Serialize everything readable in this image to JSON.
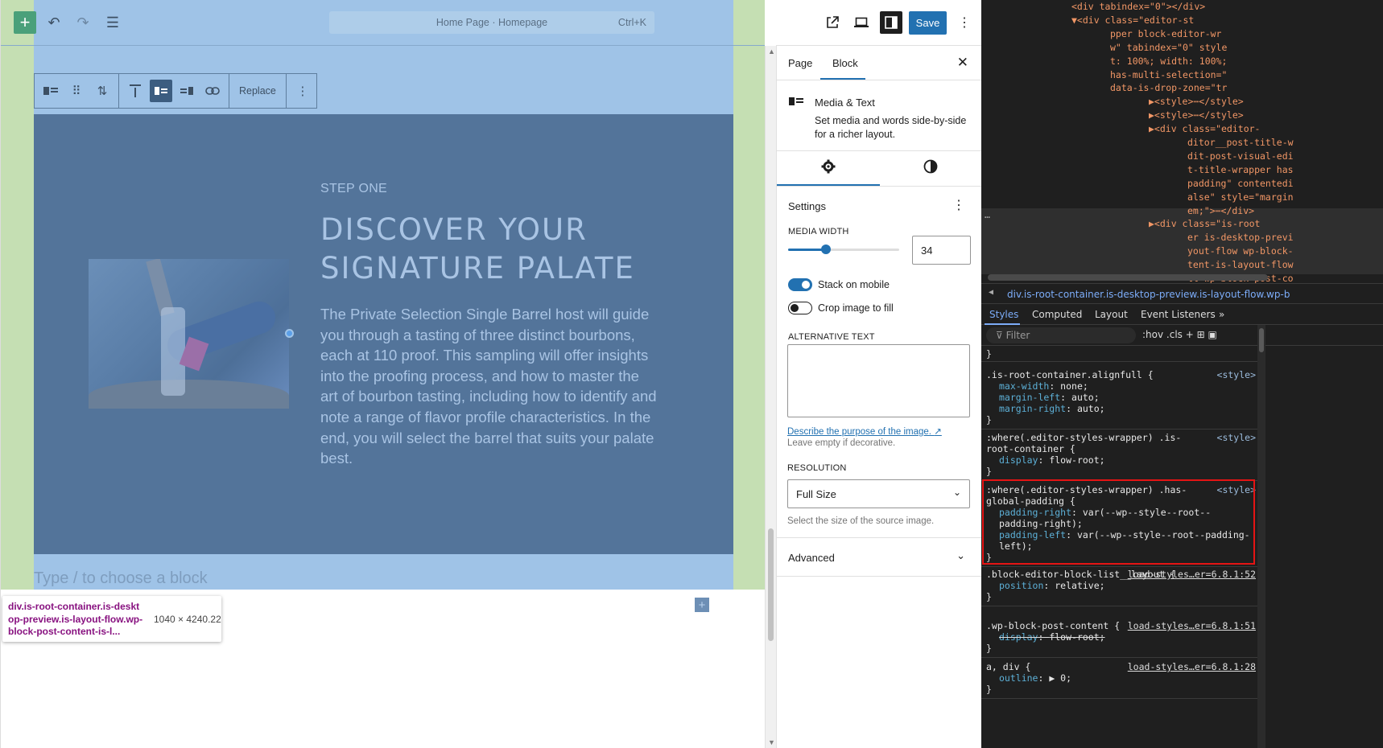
{
  "editor": {
    "toolbar": {
      "add_icon": "+",
      "undo_icon": "↶",
      "redo_icon": "↷",
      "list_view_icon": "☰",
      "document_title": "Home Page · Homepage",
      "shortcut": "Ctrl+K"
    },
    "block_toolbar": {
      "block_type_icon": "media-text-icon",
      "drag_icon": "⠿",
      "move_icon": "⇅",
      "replace_label": "Replace",
      "more_icon": "⋮"
    },
    "block": {
      "step_label": "STEP ONE",
      "heading": "DISCOVER YOUR SIGNATURE PALATE",
      "body": "The Private Selection Single Barrel host will guide you through a tasting of three distinct bourbons, each at 110 proof. This sampling will offer insights into the proofing process, and how to master the art of bourbon tasting, including how to identify and note a range of flavor profile characteristics. In the end, you will select the barrel that suits your palate best.",
      "inner_add_icon": "+",
      "appender_placeholder": "Type / to choose a block"
    },
    "inspect_tooltip": {
      "selector": "div.is-root-container.is-desktop-preview.is-layout-flow.wp-block-post-content-is-l...",
      "dimensions": "1040 × 4240.22"
    },
    "colors": {
      "guide_green": "#c5dfb3",
      "overlay_blue": "#9fc3e7",
      "block_bg": "#53749a",
      "add_button": "#4aa07a"
    }
  },
  "header_actions": {
    "view_icon": "external-link-icon",
    "device_icon": "laptop-icon",
    "settings_icon": "sidebar-toggle-icon",
    "save_label": "Save",
    "options_icon": "⋮"
  },
  "sidebar": {
    "tabs": [
      "Page",
      "Block"
    ],
    "active_tab": "Block",
    "close_icon": "✕",
    "block_card": {
      "icon": "media-text-icon",
      "name": "Media & Text",
      "description": "Set media and words side-by-side for a richer layout."
    },
    "sub_tabs": {
      "settings_icon": "gear-icon",
      "styles_icon": "contrast-icon"
    },
    "settings": {
      "title": "Settings",
      "more_icon": "⋮",
      "media_width_label": "MEDIA WIDTH",
      "media_width_value": "34",
      "media_width_percent": 34,
      "stack_on_mobile_label": "Stack on mobile",
      "stack_on_mobile": true,
      "crop_image_label": "Crop image to fill",
      "crop_image": false,
      "alt_text_label": "ALTERNATIVE TEXT",
      "alt_text_value": "",
      "alt_link": "Describe the purpose of the image.",
      "alt_link_icon": "↗",
      "alt_help": "Leave empty if decorative.",
      "resolution_label": "RESOLUTION",
      "resolution_value": "Full Size",
      "resolution_help": "Select the size of the source image."
    },
    "advanced_label": "Advanced",
    "accent": "#2271b1"
  },
  "devtools": {
    "dom_lines": [
      {
        "indent": 14,
        "text": "<div tabindex=\"0\"></div>"
      },
      {
        "indent": 14,
        "text": "▼<div class=\"editor-st"
      },
      {
        "indent": 20,
        "text": "pper block-editor-wr"
      },
      {
        "indent": 20,
        "text": "w\" tabindex=\"0\" style"
      },
      {
        "indent": 20,
        "text": "t: 100%; width: 100%;"
      },
      {
        "indent": 20,
        "text": "has-multi-selection=\""
      },
      {
        "indent": 20,
        "text": "data-is-drop-zone=\"tr"
      },
      {
        "indent": 26,
        "text": "▶<style>⋯</style>"
      },
      {
        "indent": 26,
        "text": "▶<style>⋯</style>"
      },
      {
        "indent": 26,
        "text": "▶<div class=\"editor-"
      },
      {
        "indent": 32,
        "text": "ditor__post-title-w"
      },
      {
        "indent": 32,
        "text": "dit-post-visual-edi"
      },
      {
        "indent": 32,
        "text": "t-title-wrapper has"
      },
      {
        "indent": 32,
        "text": "padding\" contentedi"
      },
      {
        "indent": 32,
        "text": "alse\" style=\"margin"
      },
      {
        "indent": 32,
        "text": "em;\">⋯</div>"
      },
      {
        "indent": 26,
        "text": "▶<div class=\"is-root"
      },
      {
        "indent": 32,
        "text": "er is-desktop-previ"
      },
      {
        "indent": 32,
        "text": "yout-flow wp-block-"
      },
      {
        "indent": 32,
        "text": "tent-is-layout-flow"
      },
      {
        "indent": 32,
        "text": "ll wp-block-post-co"
      }
    ],
    "dom_more": "…",
    "breadcrumb": "div.is-root-container.is-desktop-preview.is-layout-flow.wp-b",
    "tabs": [
      "Styles",
      "Computed",
      "Layout",
      "Event Listeners"
    ],
    "tabs_more": "»",
    "filter_placeholder": "Filter",
    "filter_tools": ":hov  .cls  +  ⊞  ▣",
    "rules": [
      {
        "selector": ".is-root-container.alignfull {",
        "source": "<style>",
        "props": [
          {
            "name": "max-width",
            "value": "none;"
          },
          {
            "name": "margin-left",
            "value": "auto;"
          },
          {
            "name": "margin-right",
            "value": "auto;"
          }
        ]
      },
      {
        "selector": ":where(.editor-styles-wrapper) .is-root-container {",
        "source": "<style>",
        "props": [
          {
            "name": "display",
            "value": "flow-root;"
          }
        ]
      },
      {
        "selector": ":where(.editor-styles-wrapper) .has-global-padding {",
        "source": "<style>",
        "props": [
          {
            "name": "padding-right",
            "value": "var(--wp--style--root--padding-right);"
          },
          {
            "name": "padding-left",
            "value": "var(--wp--style--root--padding-left);"
          }
        ]
      },
      {
        "selector": ".block-editor-block-list__layout {",
        "source": "load-styles…er=6.8.1:52",
        "props": [
          {
            "name": "position",
            "value": "relative;"
          }
        ]
      },
      {
        "selector": ".wp-block-post-content {",
        "source": "load-styles…er=6.8.1:51",
        "props": [
          {
            "name": "display",
            "value": "flow-root;"
          }
        ]
      },
      {
        "selector": "a, div {",
        "source": "load-styles…er=6.8.1:28",
        "props": [
          {
            "name": "outline",
            "value": "▶ 0;"
          }
        ]
      }
    ],
    "highlight_color": "#e51414"
  }
}
